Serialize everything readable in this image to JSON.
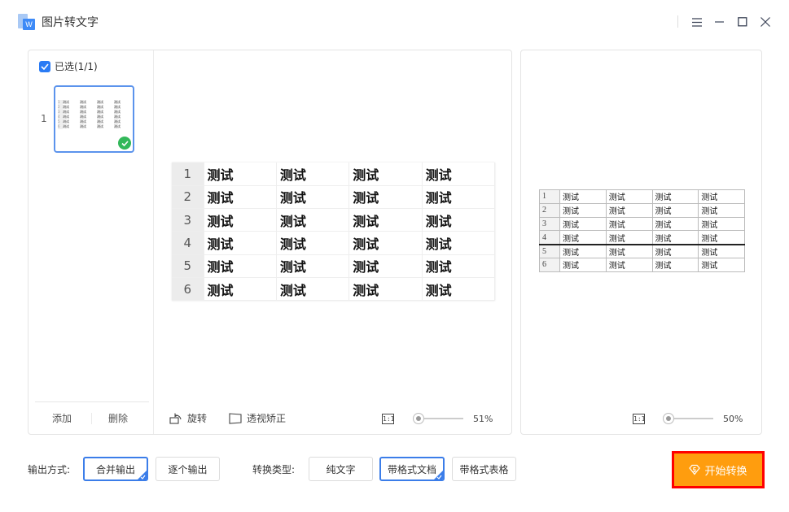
{
  "window": {
    "title": "图片转文字",
    "logo_letter": "W",
    "controls": {
      "menu": "menu-icon",
      "minimize": "minimize-icon",
      "maximize": "maximize-icon",
      "close": "close-icon"
    }
  },
  "sidebar": {
    "select_all_label": "已选(1/1)",
    "select_all_checked": true,
    "pages": [
      {
        "number": "1",
        "selected": true
      }
    ],
    "add_label": "添加",
    "delete_label": "删除"
  },
  "source_preview": {
    "table": {
      "rows": [
        {
          "n": "1",
          "cells": [
            "测试",
            "测试",
            "测试",
            "测试"
          ]
        },
        {
          "n": "2",
          "cells": [
            "测试",
            "测试",
            "测试",
            "测试"
          ]
        },
        {
          "n": "3",
          "cells": [
            "测试",
            "测试",
            "测试",
            "测试"
          ]
        },
        {
          "n": "4",
          "cells": [
            "测试",
            "测试",
            "测试",
            "测试"
          ]
        },
        {
          "n": "5",
          "cells": [
            "测试",
            "测试",
            "测试",
            "测试"
          ]
        },
        {
          "n": "6",
          "cells": [
            "测试",
            "测试",
            "测试",
            "测试"
          ]
        }
      ]
    },
    "rotate_label": "旋转",
    "perspective_label": "透视矫正",
    "fit_label": "1:1",
    "zoom_percent": "51%",
    "zoom_value": 0.51
  },
  "result_preview": {
    "table": {
      "rows": [
        {
          "n": "1",
          "cells": [
            "测试",
            "测试",
            "测试",
            "测试"
          ]
        },
        {
          "n": "2",
          "cells": [
            "测试",
            "测试",
            "测试",
            "测试"
          ]
        },
        {
          "n": "3",
          "cells": [
            "测试",
            "测试",
            "测试",
            "测试"
          ]
        },
        {
          "n": "4",
          "cells": [
            "测试",
            "测试",
            "测试",
            "测试"
          ]
        },
        {
          "n": "5",
          "cells": [
            "测试",
            "测试",
            "测试",
            "测试"
          ]
        },
        {
          "n": "6",
          "cells": [
            "测试",
            "测试",
            "测试",
            "测试"
          ]
        }
      ]
    },
    "fit_label": "1:1",
    "zoom_percent": "50%",
    "zoom_value": 0.5
  },
  "options": {
    "output_mode_label": "输出方式:",
    "output_modes": [
      {
        "label": "合并输出",
        "selected": true
      },
      {
        "label": "逐个输出",
        "selected": false
      }
    ],
    "convert_type_label": "转换类型:",
    "convert_types": [
      {
        "label": "纯文字",
        "selected": false
      },
      {
        "label": "带格式文档",
        "selected": true
      },
      {
        "label": "带格式表格",
        "selected": false
      }
    ]
  },
  "start_button": {
    "label": "开始转换",
    "icon": "vip-shield-icon"
  },
  "colors": {
    "accent": "#3b7de9",
    "start_button": "#ff9d0e",
    "highlight_border": "#ff0000",
    "success": "#33b85a"
  }
}
